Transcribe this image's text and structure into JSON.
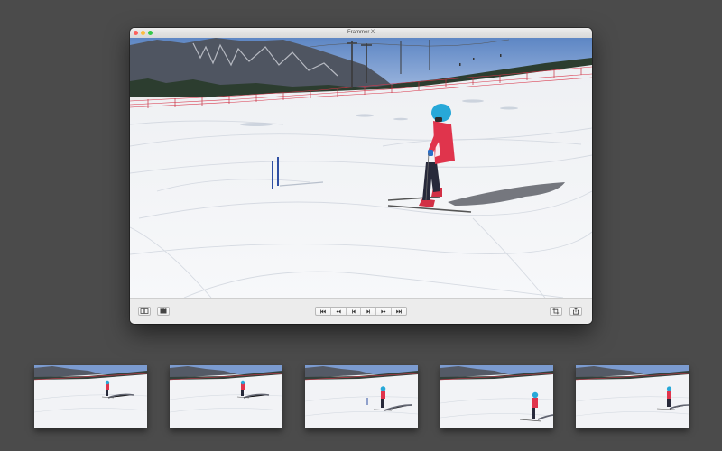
{
  "window": {
    "title": "Frammer X"
  },
  "controls": {
    "left": [
      {
        "name": "book-view-button",
        "icon": "book-icon"
      },
      {
        "name": "filmstrip-button",
        "icon": "film-icon"
      }
    ],
    "transport": [
      {
        "name": "skip-to-start-button",
        "icon": "skip-back-icon"
      },
      {
        "name": "rewind-button",
        "icon": "rewind-icon"
      },
      {
        "name": "step-back-button",
        "icon": "step-back-icon"
      },
      {
        "name": "step-forward-button",
        "icon": "step-forward-icon"
      },
      {
        "name": "fast-forward-button",
        "icon": "fast-forward-icon"
      },
      {
        "name": "skip-to-end-button",
        "icon": "skip-forward-icon"
      }
    ],
    "right": [
      {
        "name": "crop-button",
        "icon": "crop-icon"
      },
      {
        "name": "share-button",
        "icon": "share-icon"
      }
    ]
  },
  "filmstrip": {
    "frame_count": 5
  },
  "colors": {
    "desktop": "#4b4b4b",
    "sky": "#6f93c9",
    "helmet": "#27a8d8",
    "jacket": "#e0344c"
  }
}
